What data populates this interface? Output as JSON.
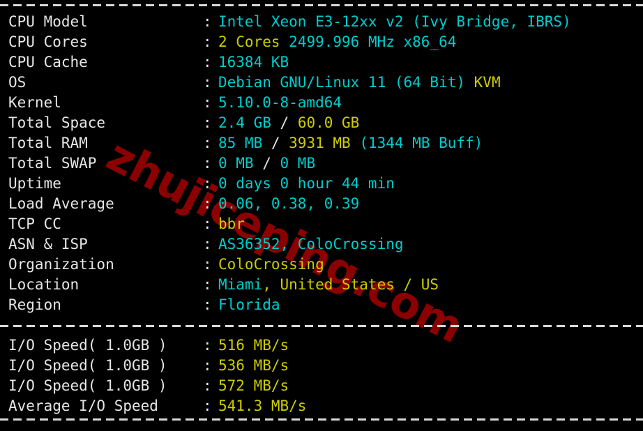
{
  "terminal": {
    "background_color": "#000000",
    "label_color": "#e6e6e6",
    "cyan_color": "#00cdcd",
    "yellow_color": "#cdcd00",
    "separator_color": "#d8d8d8",
    "watermark_color": "#8B0000",
    "watermark_text": "zhujiceping.com",
    "colon": ":"
  },
  "system_info": {
    "rows": [
      {
        "label": "CPU Model",
        "segments": [
          {
            "text": "Intel Xeon E3-12xx v2 (Ivy Bridge, IBRS)",
            "color": "cyan"
          }
        ]
      },
      {
        "label": "CPU Cores",
        "segments": [
          {
            "text": "2 Cores ",
            "color": "yellow"
          },
          {
            "text": "2499.996 MHz x86_64",
            "color": "cyan"
          }
        ]
      },
      {
        "label": "CPU Cache",
        "segments": [
          {
            "text": "16384 KB",
            "color": "cyan"
          }
        ]
      },
      {
        "label": "OS",
        "segments": [
          {
            "text": "Debian GNU/Linux 11 (64 Bit) ",
            "color": "cyan"
          },
          {
            "text": "KVM",
            "color": "yellow"
          }
        ]
      },
      {
        "label": "Kernel",
        "segments": [
          {
            "text": "5.10.0-8-amd64",
            "color": "cyan"
          }
        ]
      },
      {
        "label": "Total Space",
        "segments": [
          {
            "text": "2.4 GB ",
            "color": "cyan"
          },
          {
            "text": "/ ",
            "color": "white"
          },
          {
            "text": "60.0 GB",
            "color": "yellow"
          }
        ]
      },
      {
        "label": "Total RAM",
        "segments": [
          {
            "text": "85 MB ",
            "color": "cyan"
          },
          {
            "text": "/ ",
            "color": "white"
          },
          {
            "text": "3931 MB ",
            "color": "yellow"
          },
          {
            "text": "(1344 MB Buff)",
            "color": "cyan"
          }
        ]
      },
      {
        "label": "Total SWAP",
        "segments": [
          {
            "text": "0 MB ",
            "color": "cyan"
          },
          {
            "text": "/ ",
            "color": "white"
          },
          {
            "text": "0 MB",
            "color": "cyan"
          }
        ]
      },
      {
        "label": "Uptime",
        "segments": [
          {
            "text": "0 days 0 hour 44 min",
            "color": "cyan"
          }
        ]
      },
      {
        "label": "Load Average",
        "segments": [
          {
            "text": "0.06, 0.38, 0.39",
            "color": "cyan"
          }
        ]
      },
      {
        "label": "TCP CC",
        "segments": [
          {
            "text": "bbr",
            "color": "yellow"
          }
        ]
      },
      {
        "label": "ASN & ISP",
        "segments": [
          {
            "text": "AS36352, ColoCrossing",
            "color": "cyan"
          }
        ]
      },
      {
        "label": "Organization",
        "segments": [
          {
            "text": "ColoCrossing",
            "color": "yellow"
          }
        ]
      },
      {
        "label": "Location",
        "segments": [
          {
            "text": "Miami",
            "color": "cyan"
          },
          {
            "text": ", United States / US",
            "color": "yellow"
          }
        ]
      },
      {
        "label": "Region",
        "segments": [
          {
            "text": "Florida",
            "color": "cyan"
          }
        ]
      }
    ]
  },
  "io_speed": {
    "rows": [
      {
        "label": "I/O Speed( 1.0GB )",
        "segments": [
          {
            "text": "516 MB/s",
            "color": "yellow"
          }
        ]
      },
      {
        "label": "I/O Speed( 1.0GB )",
        "segments": [
          {
            "text": "536 MB/s",
            "color": "yellow"
          }
        ]
      },
      {
        "label": "I/O Speed( 1.0GB )",
        "segments": [
          {
            "text": "572 MB/s",
            "color": "yellow"
          }
        ]
      },
      {
        "label": "Average I/O Speed",
        "segments": [
          {
            "text": "541.3 MB/s",
            "color": "yellow"
          }
        ]
      }
    ]
  }
}
